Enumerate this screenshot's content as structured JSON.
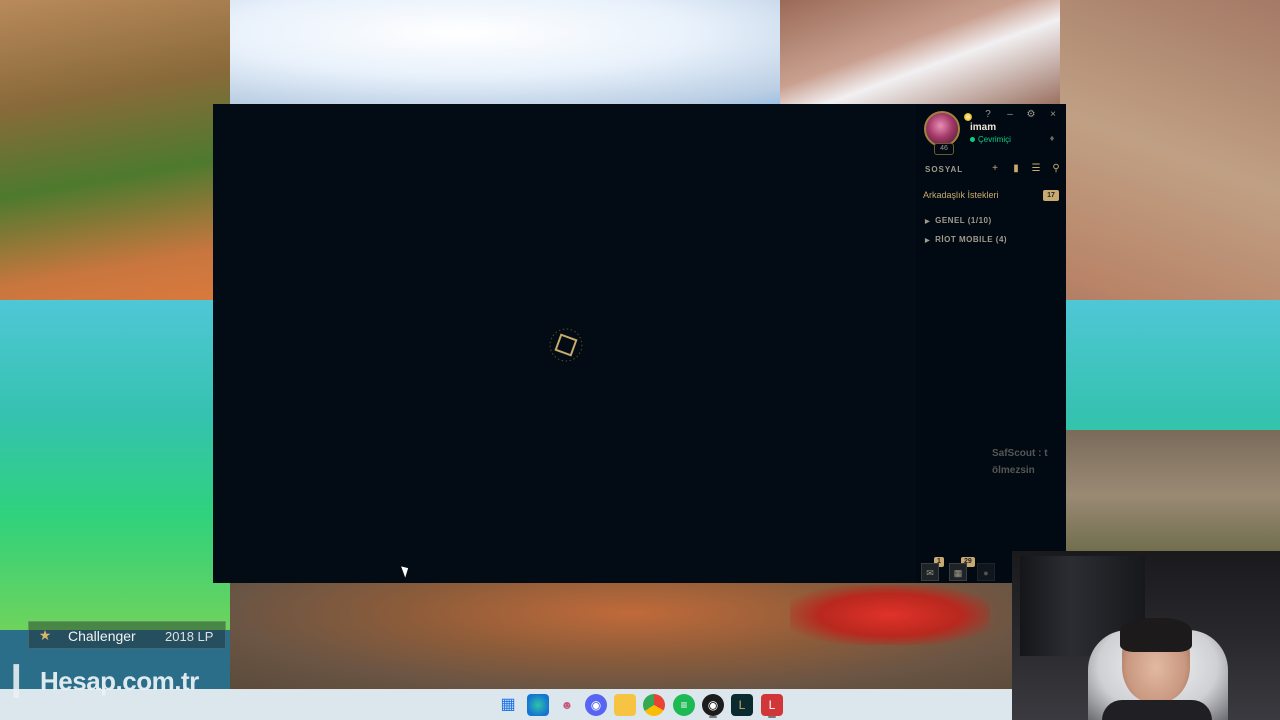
{
  "client": {
    "profile": {
      "username": "imam",
      "status": "Çevrimiçi",
      "level": "46"
    },
    "window_controls": {
      "help": "?",
      "minimize": "–",
      "settings": "⚙",
      "close": "×"
    },
    "social": {
      "header": "SOSYAL",
      "friend_requests_label": "Arkadaşlık İstekleri",
      "friend_requests_count": "17",
      "groups": [
        {
          "label": "GENEL (1/10)"
        },
        {
          "label": "RİOT MOBILE (4)"
        }
      ]
    },
    "chat_overlay": {
      "line1": "SafScout : t",
      "line2": "ölmezsin"
    },
    "bottom_bar": {
      "chat_badge": "1",
      "mission_badge": "29"
    }
  },
  "stream_overlay": {
    "rank_name": "Challenger",
    "rank_lp": "2018 LP",
    "watermark": "Hesap.com.tr"
  },
  "taskbar": {
    "icons": [
      "windows-start-icon",
      "edge-icon",
      "app-icon",
      "discord-icon",
      "file-explorer-icon",
      "chrome-icon",
      "spotify-icon",
      "obs-icon",
      "league-icon",
      "riot-client-icon"
    ]
  },
  "colors": {
    "client_bg": "#030b14",
    "gold": "#c8aa6e",
    "online_green": "#0acf83",
    "text_muted": "#a09b8c"
  }
}
